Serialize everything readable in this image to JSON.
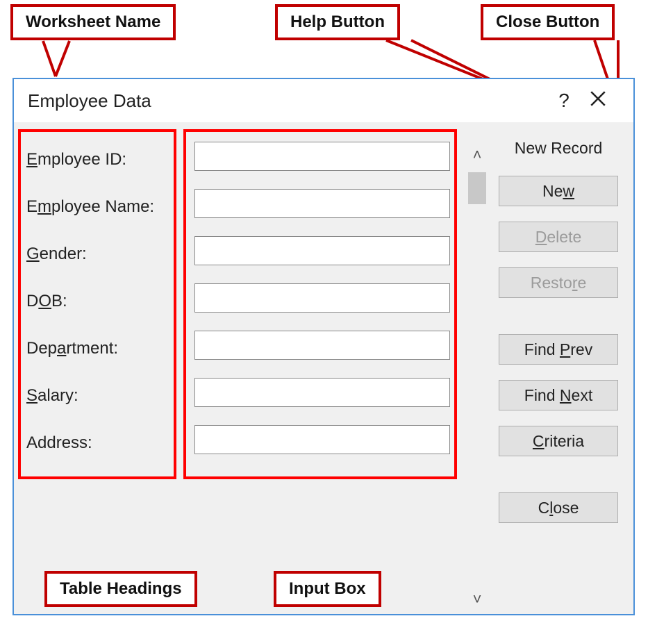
{
  "callouts": {
    "worksheet_name": "Worksheet Name",
    "help_button": "Help Button",
    "close_button": "Close Button",
    "table_headings": "Table Headings",
    "input_box": "Input Box"
  },
  "dialog": {
    "title": "Employee Data",
    "help_glyph": "?",
    "record_status": "New Record",
    "fields": [
      {
        "label_pre": "",
        "label_u": "E",
        "label_post": "mployee ID:",
        "value": ""
      },
      {
        "label_pre": "E",
        "label_u": "m",
        "label_post": "ployee Name:",
        "value": ""
      },
      {
        "label_pre": "",
        "label_u": "G",
        "label_post": "ender:",
        "value": ""
      },
      {
        "label_pre": "D",
        "label_u": "O",
        "label_post": "B:",
        "value": ""
      },
      {
        "label_pre": "Dep",
        "label_u": "a",
        "label_post": "rtment:",
        "value": ""
      },
      {
        "label_pre": "",
        "label_u": "S",
        "label_post": "alary:",
        "value": ""
      },
      {
        "label_pre": "Address:",
        "label_u": "",
        "label_post": "",
        "value": ""
      }
    ],
    "buttons": {
      "new": {
        "pre": "Ne",
        "u": "w",
        "post": "",
        "enabled": true
      },
      "delete": {
        "pre": "",
        "u": "D",
        "post": "elete",
        "enabled": false
      },
      "restore": {
        "pre": "Resto",
        "u": "r",
        "post": "e",
        "enabled": false
      },
      "find_prev": {
        "pre": "Find ",
        "u": "P",
        "post": "rev",
        "enabled": true
      },
      "find_next": {
        "pre": "Find ",
        "u": "N",
        "post": "ext",
        "enabled": true
      },
      "criteria": {
        "pre": "",
        "u": "C",
        "post": "riteria",
        "enabled": true
      },
      "close": {
        "pre": "C",
        "u": "l",
        "post": "ose",
        "enabled": true
      }
    }
  }
}
